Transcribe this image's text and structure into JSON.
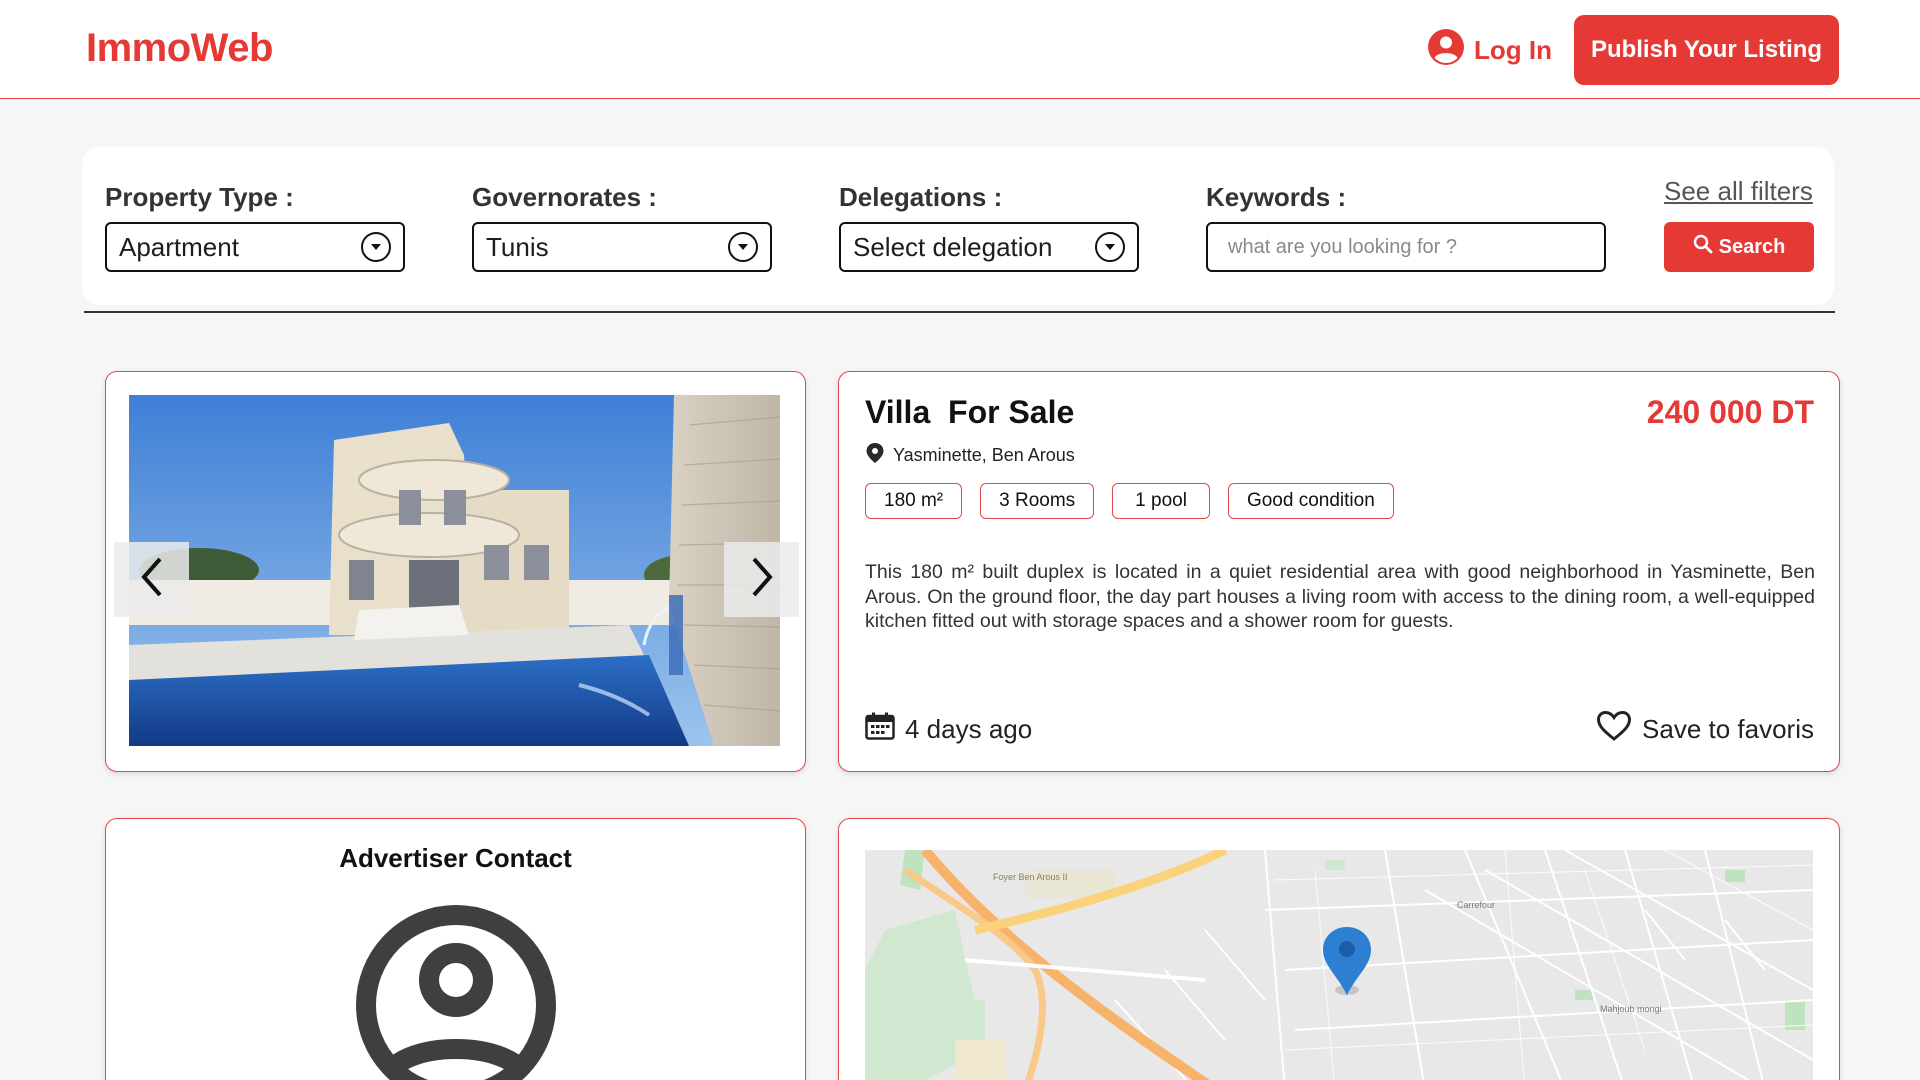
{
  "header": {
    "logo": "ImmoWeb",
    "login_label": "Log In",
    "publish_label": "Publish Your Listing"
  },
  "search": {
    "property_type_label": "Property Type :",
    "property_type_value": "Apartment",
    "governorates_label": "Governorates :",
    "governorates_value": "Tunis",
    "delegations_label": "Delegations :",
    "delegations_value": "Select delegation",
    "keywords_label": "Keywords :",
    "keywords_placeholder": "what are you looking for ?",
    "see_all_filters": "See all filters",
    "search_label": "Search"
  },
  "listing": {
    "title": "Villa  For Sale",
    "price": "240 000 DT",
    "location": "Yasminette, Ben Arous",
    "tags": [
      "180 m²",
      "3 Rooms",
      "1 pool",
      "Good condition"
    ],
    "description": "This 180 m² built duplex is located in a quiet residential area with good neighborhood in Yasminette, Ben Arous. On the ground floor, the day part houses a living room with access to the dining room, a well-equipped kitchen fitted out with storage spaces and a shower room for guests.",
    "posted": "4 days ago",
    "save_label": "Save to favoris"
  },
  "contact": {
    "title": "Advertiser Contact"
  },
  "map": {
    "labels": [
      "Foyer Ben Arous II",
      "Carrefour",
      "Mahjoub mongi"
    ]
  },
  "colors": {
    "accent": "#e53935",
    "text": "#1d1d1d",
    "background": "#f6f6f6"
  },
  "icons": {
    "login": "user-circle-icon",
    "search": "magnifier-icon",
    "location": "location-pin-icon",
    "calendar": "calendar-icon",
    "favorite": "heart-outline-icon",
    "avatar": "user-avatar-icon",
    "map_marker": "map-marker-icon"
  }
}
